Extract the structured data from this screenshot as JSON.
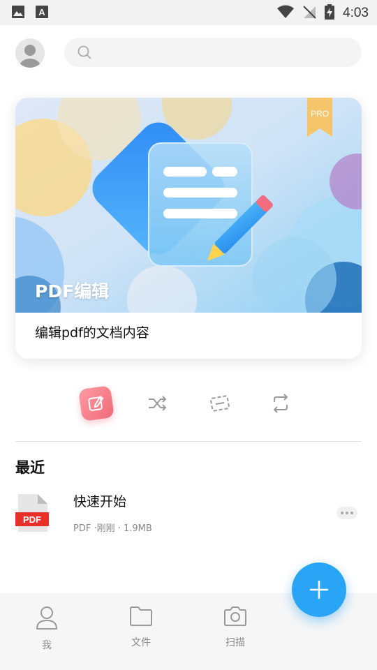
{
  "status_bar": {
    "time": "4:03"
  },
  "search": {
    "placeholder": ""
  },
  "banner": {
    "title": "PDF编辑",
    "badge": "PRO",
    "description": "编辑pdf的文档内容"
  },
  "tools": [
    {
      "icon": "edit-icon",
      "active": true
    },
    {
      "icon": "shuffle-icon",
      "active": false
    },
    {
      "icon": "scan-frame-icon",
      "active": false
    },
    {
      "icon": "convert-icon",
      "active": false
    }
  ],
  "recent": {
    "title": "最近",
    "files": [
      {
        "name": "快速开始",
        "meta": "PDF ·刚刚 · 1.9MB",
        "type_label": "PDF"
      }
    ]
  },
  "nav": [
    {
      "label": "我",
      "icon": "person-icon"
    },
    {
      "label": "文件",
      "icon": "folder-icon"
    },
    {
      "label": "扫描",
      "icon": "camera-icon"
    }
  ],
  "colors": {
    "accent": "#2aa4f4",
    "pdf_red": "#e8302a",
    "edit_pink": "#f06a79"
  }
}
